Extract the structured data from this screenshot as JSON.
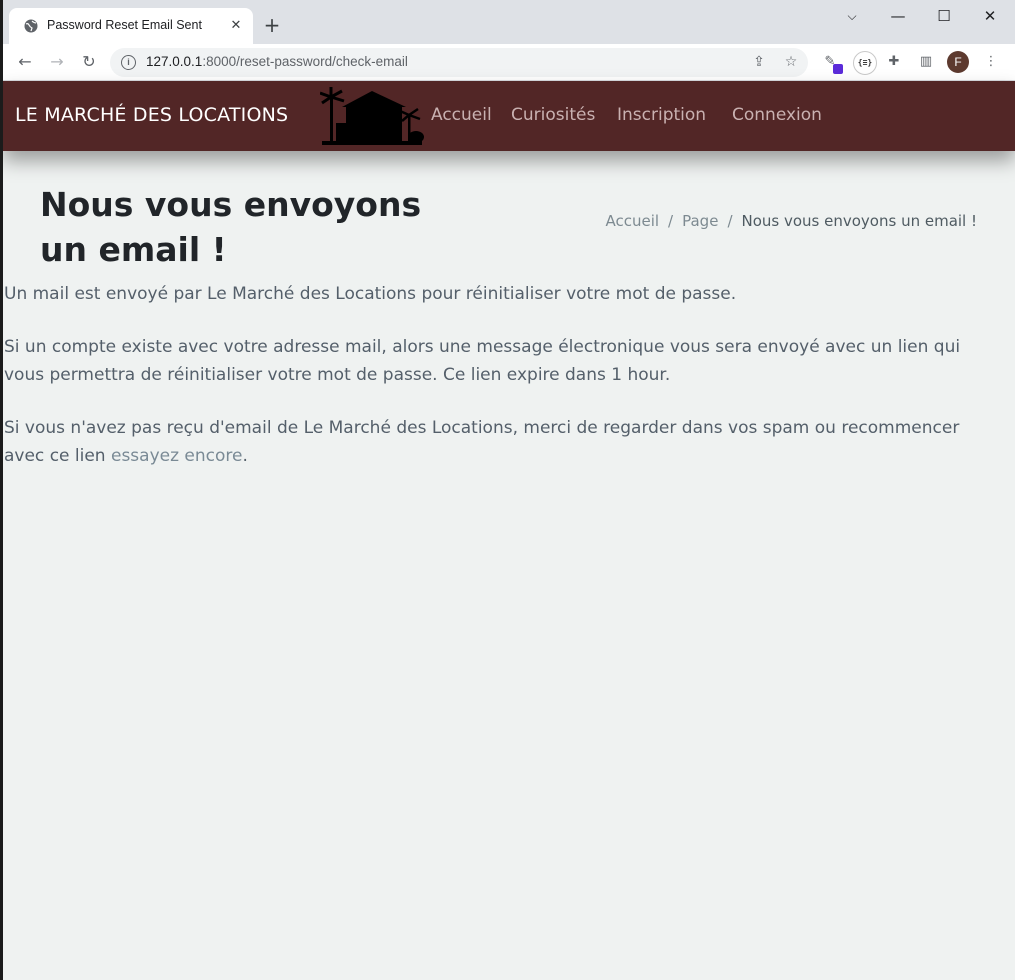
{
  "browser": {
    "tab_title": "Password Reset Email Sent",
    "url_host": "127.0.0.1",
    "url_rest": ":8000/reset-password/check-email",
    "avatar_initial": "F"
  },
  "navbar": {
    "brand": "LE MARCHÉ DES LOCATIONS",
    "links": [
      "Accueil",
      "Curiosités",
      "Inscription",
      "Connexion"
    ],
    "background": "#522626"
  },
  "page": {
    "title": "Nous vous envoyons un email !",
    "breadcrumb": [
      "Accueil",
      "Page",
      "Nous vous envoyons un email !"
    ],
    "paragraph1": "Un mail est envoyé par Le Marché des Locations pour réinitialiser votre mot de passe.",
    "paragraph2": "Si un compte existe avec votre adresse mail, alors une message électronique vous sera envoyé avec un lien qui vous permettra de réinitialiser votre mot de passe. Ce lien expire dans 1 hour.",
    "paragraph3_text": "Si vous n'avez pas reçu d'email de Le Marché des Locations, merci de regarder dans vos spam ou recommencer avec ce lien ",
    "retry_link": "essayez encore",
    "paragraph3_end": "."
  }
}
